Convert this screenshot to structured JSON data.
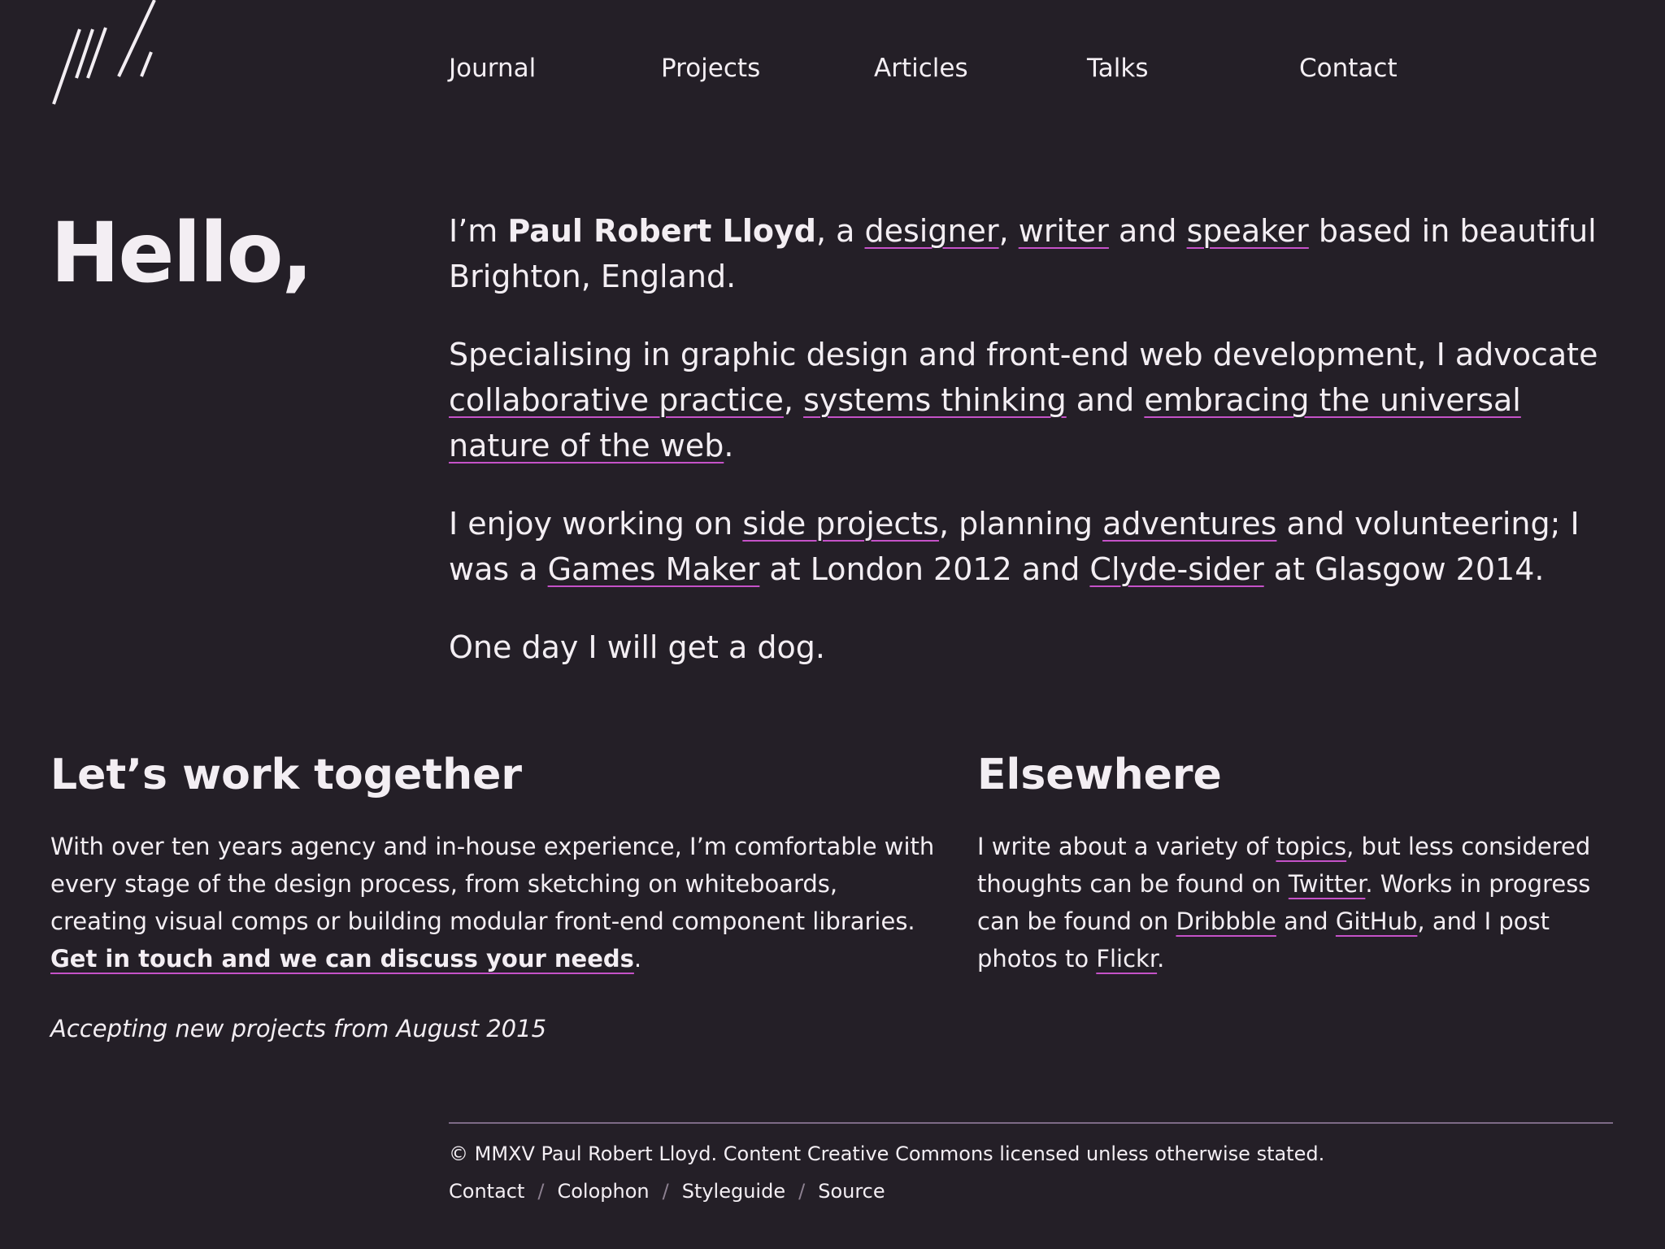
{
  "site": {
    "logo_icon": "logo-mark-icon"
  },
  "nav": {
    "items": [
      {
        "label": "Journal"
      },
      {
        "label": "Projects"
      },
      {
        "label": "Articles"
      },
      {
        "label": "Talks"
      },
      {
        "label": "Contact"
      }
    ]
  },
  "hero": {
    "greeting": "Hello,"
  },
  "intro": {
    "p1": {
      "prefix": "I’m ",
      "name": "Paul Robert Lloyd",
      "mid1": ", a ",
      "link_designer": "designer",
      "comma": ", ",
      "link_writer": "writer",
      "and": " and ",
      "link_speaker": "speaker",
      "suffix": " based in beautiful Brighton, England."
    },
    "p2": {
      "text": "Specialising in graphic design and front-end web development, I advocate ",
      "link_collab": "collaborative practice",
      "comma": ", ",
      "link_systems": "systems thinking",
      "and": " and ",
      "link_web": "embracing the universal nature of the web",
      "end": "."
    },
    "p3": {
      "text": "I enjoy working on ",
      "link_side": "side projects",
      "mid1": ", planning ",
      "link_adventures": "adventures",
      "mid2": " and volunteering; I was a ",
      "link_games": "Games Maker",
      "mid3": " at London 2012 and ",
      "link_clyde": "Clyde-sider",
      "end": " at Glasgow 2014."
    },
    "p4": "One day I will get a dog."
  },
  "work": {
    "heading": "Let’s work together",
    "body": "With over ten years agency and in-house experience, I’m comfortable with every stage of the design process, from sketching on whiteboards, creating visual comps or building modular front-end component libraries. ",
    "cta": "Get in touch and we can discuss your needs",
    "cta_end": ".",
    "status": "Accepting new projects from August 2015"
  },
  "elsewhere": {
    "heading": "Elsewhere",
    "t1": "I write about a variety of ",
    "link_topics": "topics",
    "t2": ", but less considered thoughts can be found on ",
    "link_twitter": "Twitter",
    "t3": ". Works in progress can be found on ",
    "link_dribbble": "Dribbble",
    "t4": " and ",
    "link_github": "GitHub",
    "t5": ", and I post photos to ",
    "link_flickr": "Flickr",
    "t6": "."
  },
  "footer": {
    "copyright": "© MMXV Paul Robert Lloyd. Content Creative Commons licensed unless otherwise stated.",
    "separator": "/",
    "links": [
      {
        "label": "Contact"
      },
      {
        "label": "Colophon"
      },
      {
        "label": "Styleguide"
      },
      {
        "label": "Source"
      }
    ]
  },
  "colors": {
    "background": "#241f27",
    "text": "#f3eef3",
    "accent_underline": "#c552c8",
    "footer_rule": "#7d6a86"
  }
}
